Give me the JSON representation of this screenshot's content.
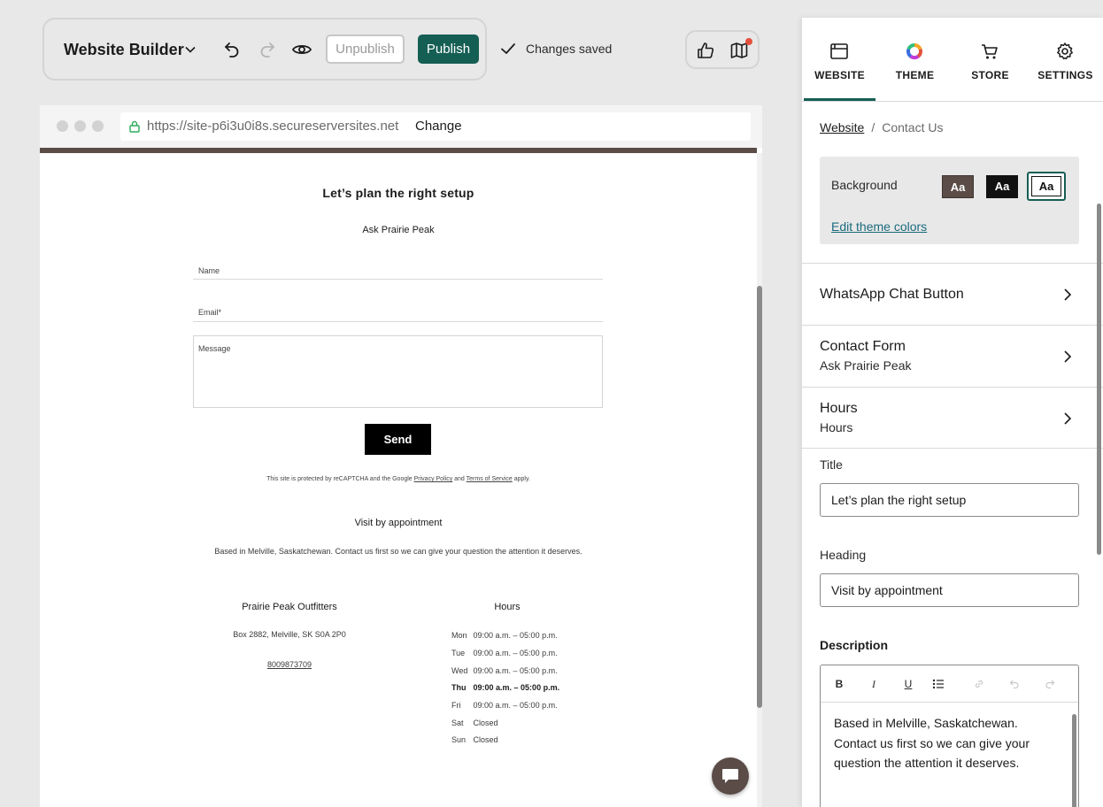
{
  "toolbar": {
    "title": "Website Builder",
    "unpublish_label": "Unpublish",
    "publish_label": "Publish",
    "status_text": "Changes saved",
    "icons": [
      "chevron-down-icon",
      "undo-icon",
      "redo-icon",
      "preview-eye-icon",
      "thumbs-up-icon",
      "map-icon"
    ]
  },
  "browser": {
    "url": "https://site-p6i3u0i8s.secureserversites.net",
    "change_label": "Change"
  },
  "site": {
    "contact_title": "Let’s plan the right setup",
    "contact_subtitle": "Ask Prairie Peak",
    "form": {
      "name_label": "Name",
      "email_label": "Email*",
      "message_label": "Message",
      "send_label": "Send"
    },
    "captcha": {
      "prefix": "This site is protected by reCAPTCHA and the Google ",
      "privacy": "Privacy Policy",
      "and": " and ",
      "terms": "Terms of Service",
      "suffix": " apply."
    },
    "heading": "Visit by appointment",
    "description": "Based in Melville, Saskatchewan. Contact us first so we can give your question the attention it deserves.",
    "business": {
      "name": "Prairie Peak Outfitters",
      "address": "Box 2882, Melville, SK S0A 2P0",
      "phone": "8009873709"
    },
    "hours": {
      "title": "Hours",
      "rows": [
        {
          "day": "Mon",
          "time": "09:00 a.m. – 05:00 p.m."
        },
        {
          "day": "Tue",
          "time": "09:00 a.m. – 05:00 p.m."
        },
        {
          "day": "Wed",
          "time": "09:00 a.m. – 05:00 p.m."
        },
        {
          "day": "Thu",
          "time": "09:00 a.m. – 05:00 p.m."
        },
        {
          "day": "Fri",
          "time": "09:00 a.m. – 05:00 p.m."
        },
        {
          "day": "Sat",
          "time": "Closed"
        },
        {
          "day": "Sun",
          "time": "Closed"
        }
      ]
    }
  },
  "panel": {
    "tabs": [
      {
        "label": "WEBSITE",
        "icon": "website-icon",
        "active": true
      },
      {
        "label": "THEME",
        "icon": "theme-color-wheel-icon",
        "active": false
      },
      {
        "label": "STORE",
        "icon": "cart-icon",
        "active": false
      },
      {
        "label": "SETTINGS",
        "icon": "gear-icon",
        "active": false
      }
    ],
    "breadcrumb": {
      "root": "Website",
      "separator": "/",
      "current": "Contact Us"
    },
    "background": {
      "label": "Background",
      "swatch_label": "Aa",
      "edit_link": "Edit theme colors",
      "swatch_colors": [
        "#5b4c48",
        "#111111",
        "#ffffff"
      ],
      "selected_index": 2
    },
    "sections": [
      {
        "title": "WhatsApp Chat Button",
        "subtitle": ""
      },
      {
        "title": "Contact Form",
        "subtitle": "Ask Prairie Peak"
      },
      {
        "title": "Hours",
        "subtitle": "Hours"
      }
    ],
    "fields": {
      "title_label": "Title",
      "title_value": "Let’s plan the right setup",
      "heading_label": "Heading",
      "heading_value": "Visit by appointment",
      "description_label": "Description",
      "description_value": "Based in Melville, Saskatchewan. Contact us first so we can give your question the attention it deserves."
    },
    "editor_tools": [
      {
        "name": "bold-button",
        "glyph": "B"
      },
      {
        "name": "italic-button",
        "glyph": "I"
      },
      {
        "name": "underline-button",
        "glyph": "U"
      },
      {
        "name": "list-button",
        "glyph": "list-icon"
      },
      {
        "name": "link-button",
        "glyph": "link-icon"
      },
      {
        "name": "editor-undo-button",
        "glyph": "undo-icon"
      },
      {
        "name": "editor-redo-button",
        "glyph": "redo-icon"
      }
    ]
  },
  "colors": {
    "accent": "#155e54",
    "brand_site": "#5b4c48",
    "link": "#1a6b7e",
    "notification": "#e4503c"
  }
}
